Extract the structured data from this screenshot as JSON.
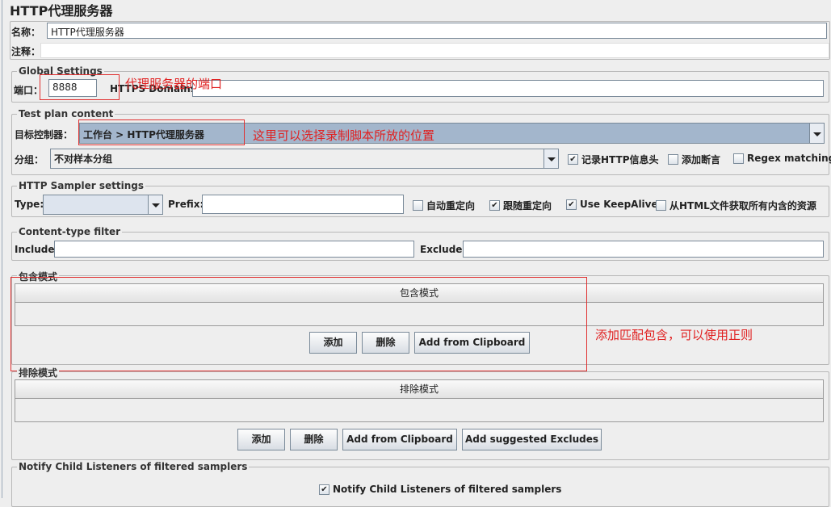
{
  "title": "HTTP代理服务器",
  "name_label": "名称：",
  "name_value": "HTTP代理服务器",
  "comment_label": "注释：",
  "comment_value": "",
  "global": {
    "legend": "Global Settings",
    "port_label": "端口：",
    "port_value": "8888",
    "https_label": "HTTPS Domains :",
    "https_value": ""
  },
  "testplan": {
    "legend": "Test plan content",
    "target_label": "目标控制器：",
    "target_value": "工作台 > HTTP代理服务器",
    "group_label": "分组：",
    "group_value": "不对样本分组",
    "checkboxes": [
      {
        "label": "记录HTTP信息头",
        "checked": true
      },
      {
        "label": "添加断言",
        "checked": false
      },
      {
        "label": "Regex matching",
        "checked": false
      }
    ]
  },
  "sampler": {
    "legend": "HTTP Sampler settings",
    "type_label": "Type:",
    "type_value": "",
    "prefix_label": "Prefix:",
    "prefix_value": "",
    "checkboxes": [
      {
        "label": "自动重定向",
        "checked": false
      },
      {
        "label": "跟随重定向",
        "checked": true
      },
      {
        "label": "Use KeepAlive",
        "checked": true
      },
      {
        "label": "从HTML文件获取所有内含的资源",
        "checked": false
      }
    ]
  },
  "content_filter": {
    "legend": "Content-type filter",
    "include_label": "Include:",
    "include_value": "",
    "exclude_label": "Exclude:",
    "exclude_value": ""
  },
  "include": {
    "title": "包含模式",
    "column": "包含模式",
    "buttons": [
      "添加",
      "删除",
      "Add from Clipboard"
    ]
  },
  "exclude": {
    "title": "排除模式",
    "column": "排除模式",
    "buttons": [
      "添加",
      "删除",
      "Add from Clipboard",
      "Add suggested Excludes"
    ]
  },
  "notify": {
    "legend": "Notify Child Listeners of filtered samplers",
    "checkbox_label": "Notify Child Listeners of filtered samplers",
    "checked": true
  },
  "annotations": {
    "port": "代理服务器的端口",
    "target": "这里可以选择录制脚本所放的位置",
    "include": "添加匹配包含，可以使用正则"
  }
}
